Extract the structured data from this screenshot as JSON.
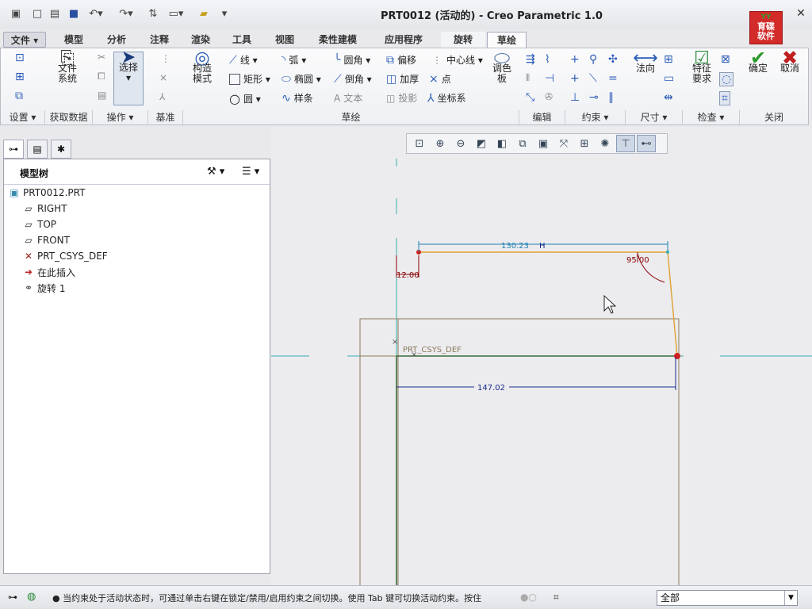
{
  "app": {
    "title": "PRT0012 (活动的) - Creo Parametric 1.0",
    "brand_line1": "YY",
    "brand_line2": "育碟",
    "brand_line3": "软件"
  },
  "tabs": [
    {
      "label": "文件 ▾"
    },
    {
      "label": "模型"
    },
    {
      "label": "分析"
    },
    {
      "label": "注释"
    },
    {
      "label": "渲染"
    },
    {
      "label": "工具"
    },
    {
      "label": "视图"
    },
    {
      "label": "柔性建模"
    },
    {
      "label": "应用程序"
    },
    {
      "label": "旋转"
    },
    {
      "label": "草绘"
    }
  ],
  "ribbon": {
    "file_system": "文件\n系统",
    "select": "选择",
    "construction_mode": "构造\n模式",
    "line": "线",
    "arc": "弧",
    "fillet": "圆角",
    "offset": "偏移",
    "centerline": "中心线",
    "rectangle": "矩形",
    "ellipse": "椭圆",
    "chamfer": "倒角",
    "thicken": "加厚",
    "point": "点",
    "circle": "圆",
    "spline": "样条",
    "text": "文本",
    "project": "投影",
    "csys": "坐标系",
    "palette": "调色\n板",
    "normal": "法向",
    "feature_req": "特征\n要求",
    "ok": "确定",
    "cancel": "取消",
    "groups": {
      "setup": "设置 ▾",
      "get_data": "获取数据",
      "operations": "操作 ▾",
      "datum": "基准",
      "sketch": "草绘",
      "edit": "编辑",
      "constrain": "约束 ▾",
      "dimension": "尺寸 ▾",
      "inspect": "检查 ▾",
      "close": "关闭"
    }
  },
  "model_tree": {
    "title": "模型树",
    "items": [
      {
        "label": "PRT0012.PRT",
        "icon": "part-icon"
      },
      {
        "label": "RIGHT",
        "icon": "datum-plane-icon"
      },
      {
        "label": "TOP",
        "icon": "datum-plane-icon"
      },
      {
        "label": "FRONT",
        "icon": "datum-plane-icon"
      },
      {
        "label": "PRT_CSYS_DEF",
        "icon": "csys-icon"
      },
      {
        "label": "在此插入",
        "icon": "insert-arrow-icon"
      },
      {
        "label": "旋转 1",
        "icon": "revolve-icon"
      }
    ]
  },
  "sketch": {
    "dim_top": "130.23",
    "dim_angle": "95.00",
    "dim_left": "12.00",
    "dim_bottom": "147.02",
    "csys_label": "PRT_CSYS_DEF",
    "colors": {
      "profile": "#e0a030",
      "dimension": "#1a7fb0",
      "dimension_strong": "#1a2a8a",
      "angle": "#8a0000",
      "axis": "#3ab0b0",
      "frame": "#8a7a5a"
    }
  },
  "status": {
    "message": "● 当约束处于活动状态时，可通过单击右键在锁定/禁用/启用约束之间切换。使用 Tab 键可切换活动约束。按住",
    "filter": "全部"
  }
}
